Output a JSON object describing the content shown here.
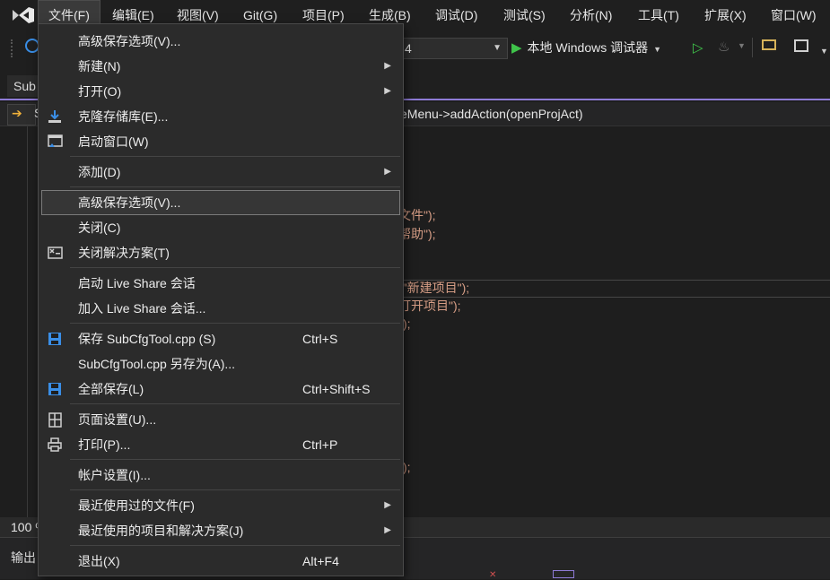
{
  "menubar": {
    "items": [
      {
        "label": "文件(F)",
        "active": true
      },
      {
        "label": "编辑(E)"
      },
      {
        "label": "视图(V)"
      },
      {
        "label": "Git(G)"
      },
      {
        "label": "项目(P)"
      },
      {
        "label": "生成(B)"
      },
      {
        "label": "调试(D)"
      },
      {
        "label": "测试(S)"
      },
      {
        "label": "分析(N)"
      },
      {
        "label": "工具(T)"
      },
      {
        "label": "扩展(X)"
      },
      {
        "label": "窗口(W)"
      }
    ]
  },
  "toolbar": {
    "platform_value": "4",
    "run_label": "本地 Windows 调试器"
  },
  "editor": {
    "tab_label": "Sub",
    "nav_left": "S",
    "nav_member": "eMenu->addAction(openProjAct)",
    "code_lines": [
      {
        "text": "文件\");"
      },
      {
        "text": "帮助\");"
      },
      {
        "text": "(\"新建项目\");"
      },
      {
        "text": "打开项目\");"
      },
      {
        "text": "\");"
      },
      {
        "text": "\");"
      }
    ],
    "zoom": "100 %",
    "output_title": "输出"
  },
  "file_menu": {
    "items": [
      {
        "label": "高级保存选项(V)...",
        "icon": ""
      },
      {
        "label": "新建(N)",
        "submenu": true
      },
      {
        "label": "打开(O)",
        "submenu": true
      },
      {
        "label": "克隆存储库(E)...",
        "icon": "clone-icon"
      },
      {
        "label": "启动窗口(W)",
        "icon": "start-window-icon"
      },
      {
        "label": "添加(D)",
        "submenu": true
      },
      {
        "label": "高级保存选项(V)...",
        "highlighted": true
      },
      {
        "label": "关闭(C)"
      },
      {
        "label": "关闭解决方案(T)",
        "icon": "close-solution-icon"
      },
      {
        "label": "启动 Live Share 会话"
      },
      {
        "label": "加入 Live Share 会话..."
      },
      {
        "label": "保存 SubCfgTool.cpp (S)",
        "shortcut": "Ctrl+S",
        "icon": "save-icon"
      },
      {
        "label": "SubCfgTool.cpp 另存为(A)..."
      },
      {
        "label": "全部保存(L)",
        "shortcut": "Ctrl+Shift+S",
        "icon": "save-all-icon"
      },
      {
        "label": "页面设置(U)...",
        "icon": "page-setup-icon"
      },
      {
        "label": "打印(P)...",
        "shortcut": "Ctrl+P",
        "icon": "print-icon"
      },
      {
        "label": "帐户设置(I)..."
      },
      {
        "label": "最近使用过的文件(F)",
        "submenu": true
      },
      {
        "label": "最近使用的项目和解决方案(J)",
        "submenu": true
      },
      {
        "label": "退出(X)",
        "shortcut": "Alt+F4"
      }
    ],
    "submenu_glyph": "▶"
  },
  "colors": {
    "accent": "#8e7bd6",
    "run_green": "#3fc34a",
    "string_color": "#d69d85",
    "save_icon_blue": "#3a8ee6"
  }
}
